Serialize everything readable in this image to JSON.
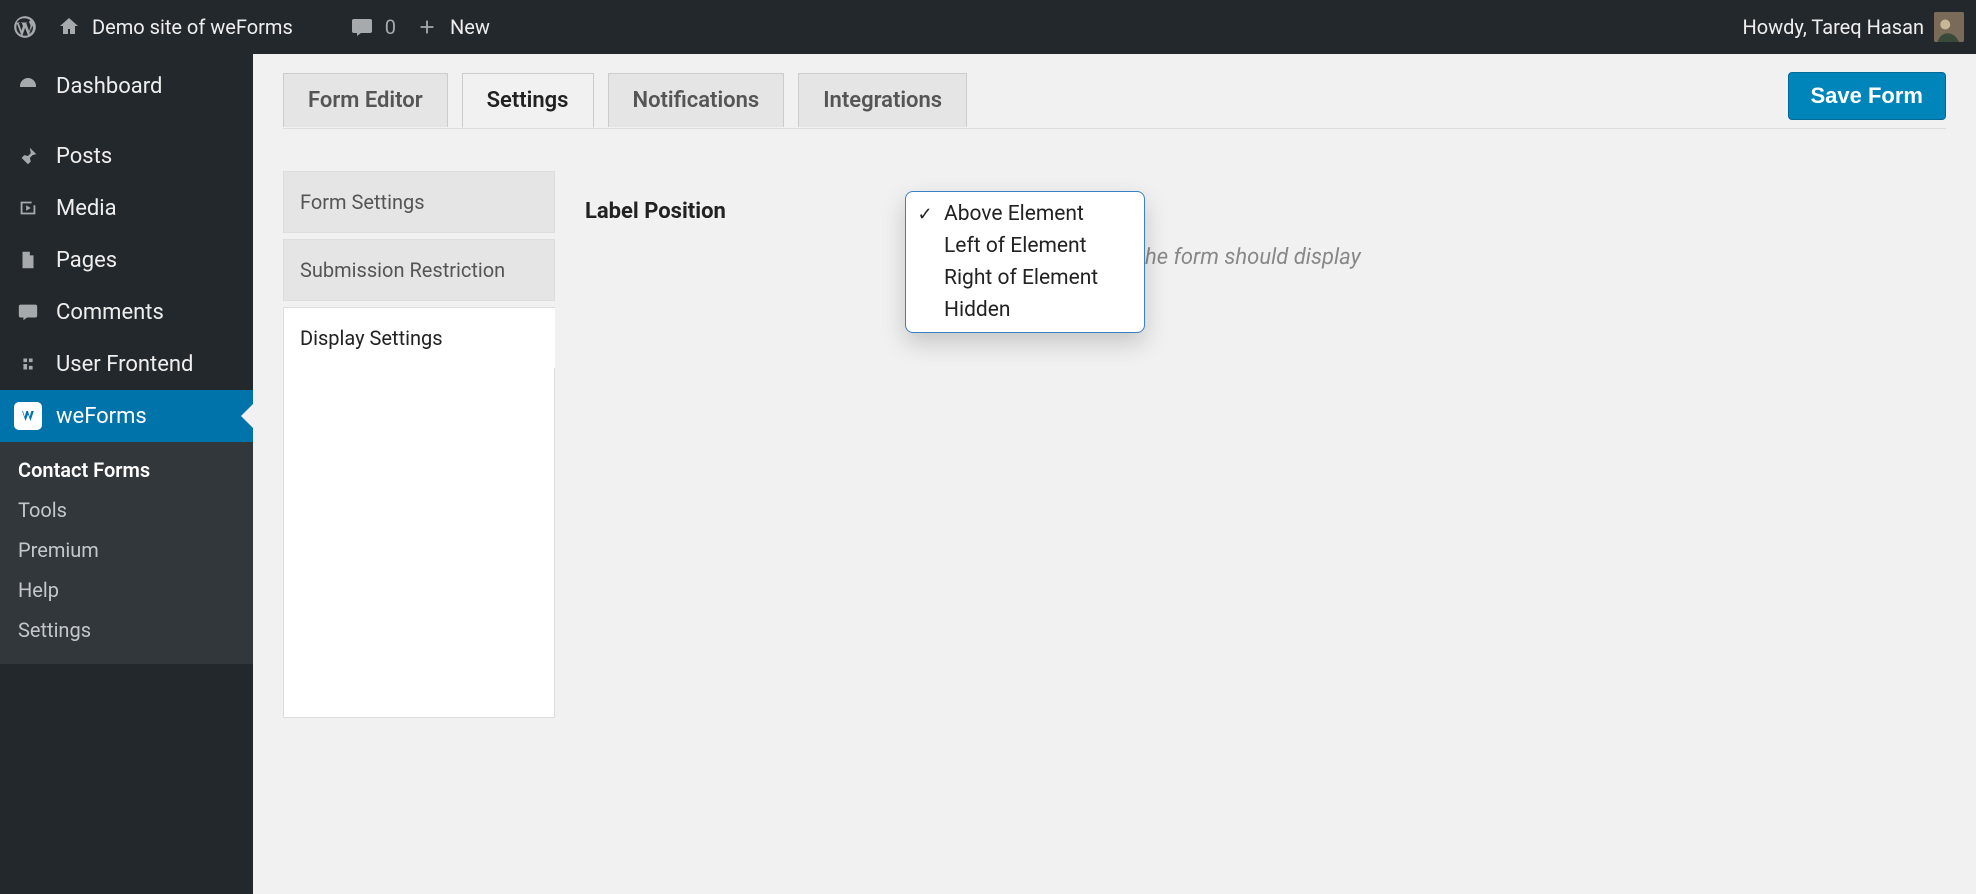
{
  "adminbar": {
    "site_title": "Demo site of weForms",
    "comment_count": "0",
    "new_label": "New",
    "howdy": "Howdy, Tareq Hasan"
  },
  "sidebar": {
    "items": [
      {
        "label": "Dashboard"
      },
      {
        "label": "Posts"
      },
      {
        "label": "Media"
      },
      {
        "label": "Pages"
      },
      {
        "label": "Comments"
      },
      {
        "label": "User Frontend"
      },
      {
        "label": "weForms"
      }
    ],
    "submenu": [
      {
        "label": "Contact Forms",
        "active": true
      },
      {
        "label": "Tools"
      },
      {
        "label": "Premium"
      },
      {
        "label": "Help"
      },
      {
        "label": "Settings"
      }
    ]
  },
  "tabs": {
    "items": [
      {
        "label": "Form Editor"
      },
      {
        "label": "Settings"
      },
      {
        "label": "Notifications"
      },
      {
        "label": "Integrations"
      }
    ],
    "save_button": "Save Form"
  },
  "settings_sidebar": {
    "items": [
      {
        "label": "Form Settings"
      },
      {
        "label": "Submission Restriction"
      },
      {
        "label": "Display Settings"
      }
    ]
  },
  "field": {
    "label": "Label Position",
    "help_text": "he form should display"
  },
  "dropdown": {
    "options": [
      {
        "label": "Above Element",
        "selected": true
      },
      {
        "label": "Left of Element"
      },
      {
        "label": "Right of Element"
      },
      {
        "label": "Hidden"
      }
    ]
  }
}
